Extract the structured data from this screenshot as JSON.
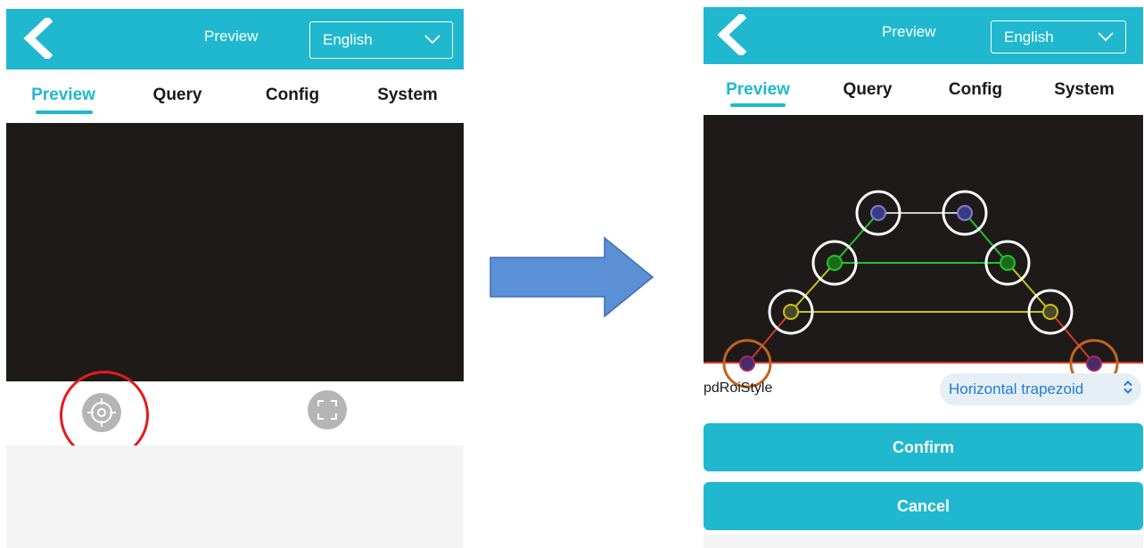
{
  "left_screen": {
    "header": {
      "title": "Preview",
      "language": "English"
    },
    "tabs": [
      {
        "label": "Preview",
        "active": true
      },
      {
        "label": "Query",
        "active": false
      },
      {
        "label": "Config",
        "active": false
      },
      {
        "label": "System",
        "active": false
      }
    ],
    "controls": {
      "target_icon": "crosshair-icon",
      "fullscreen_icon": "fullscreen-icon"
    }
  },
  "right_screen": {
    "header": {
      "title": "Preview",
      "language": "English"
    },
    "tabs": [
      {
        "label": "Preview",
        "active": true
      },
      {
        "label": "Query",
        "active": false
      },
      {
        "label": "Config",
        "active": false
      },
      {
        "label": "System",
        "active": false
      }
    ],
    "roi": {
      "label": "pdRoiStyle",
      "value": "Horizontal trapezoid"
    },
    "buttons": {
      "confirm": "Confirm",
      "cancel": "Cancel"
    }
  },
  "colors": {
    "accent": "#1fb8cf",
    "video_bg": "#1e1a1a",
    "highlight_red": "#e51b1b",
    "marker_white": "#ffffff",
    "marker_orange": "#c0651f",
    "line_white": "#cccccc",
    "line_green": "#22c32a",
    "line_yellow": "#c9c21a",
    "line_red": "#d33a2a",
    "select_text_blue": "#1b7ed6",
    "arrow_blue": "#5b8fd6"
  }
}
